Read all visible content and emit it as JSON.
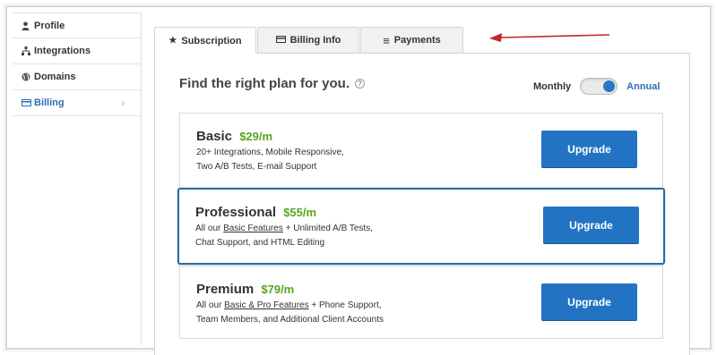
{
  "sidebar": {
    "items": [
      {
        "label": "Profile",
        "icon": "user-icon",
        "glyph": "▲"
      },
      {
        "label": "Integrations",
        "icon": "sitemap-icon",
        "glyph": "☷"
      },
      {
        "label": "Domains",
        "icon": "globe-icon",
        "glyph": "●"
      },
      {
        "label": "Billing",
        "icon": "credit-card-icon",
        "glyph": "▭",
        "active": true,
        "chevron": "›"
      }
    ]
  },
  "tabs": [
    {
      "label": "Subscription",
      "icon": "star-icon",
      "glyph": "★",
      "active": true
    },
    {
      "label": "Billing Info",
      "icon": "credit-card-icon",
      "glyph": "▭"
    },
    {
      "label": "Payments",
      "icon": "list-icon",
      "glyph": "≡"
    }
  ],
  "header": {
    "title": "Find the right plan for you.",
    "help": "?",
    "toggle": {
      "left_label": "Monthly",
      "right_label": "Annual",
      "selected": "Annual"
    }
  },
  "plans": [
    {
      "name": "Basic",
      "price": "$29/m",
      "desc_line1": "20+ Integrations, Mobile Responsive,",
      "desc_line2": "Two A/B Tests, E-mail Support",
      "button": "Upgrade"
    },
    {
      "name": "Professional",
      "price": "$55/m",
      "desc_prefix": "All our ",
      "desc_link": "Basic Features",
      "desc_suffix": " + Unlimited A/B Tests,",
      "desc_line2": "Chat Support, and HTML Editing",
      "button": "Upgrade",
      "selected": true
    },
    {
      "name": "Premium",
      "price": "$79/m",
      "desc_prefix": "All our ",
      "desc_link": "Basic & Pro Features",
      "desc_suffix": " + Phone Support,",
      "desc_line2": "Team Members, and Additional Client Accounts",
      "button": "Upgrade"
    }
  ],
  "colors": {
    "accent": "#2274c3",
    "price": "#5aa41f",
    "selected_border": "#2b6a9c",
    "annotation_arrow": "#c0262b"
  }
}
